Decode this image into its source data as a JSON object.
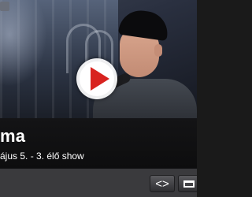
{
  "video": {
    "title": "ma",
    "subtitle": "ájus 5. - 3. élő show"
  },
  "icons": {
    "play": "play-icon",
    "embed": "code-brackets-icon",
    "fullscreen": "fullscreen-icon"
  },
  "controls": {
    "embed_label": "<>"
  },
  "colors": {
    "play_accent": "#d8231f",
    "title_text": "#ffffff",
    "control_bar": "#3a3a3d"
  }
}
